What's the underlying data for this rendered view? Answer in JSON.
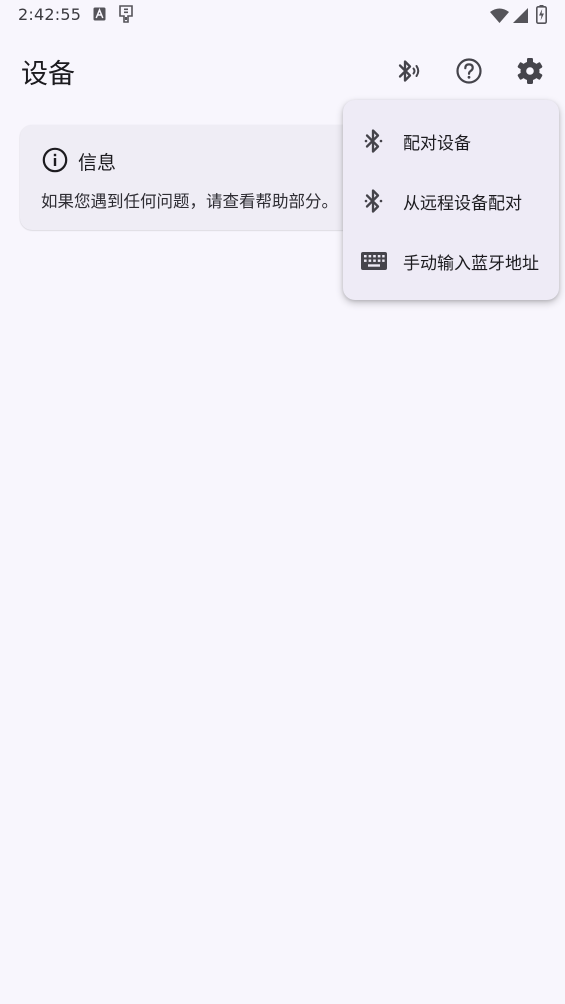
{
  "status_bar": {
    "time": "2:42:55",
    "icons": [
      "a-badge-icon",
      "sim-toolkit-icon",
      "wifi-icon",
      "signal-icon",
      "battery-charging-icon"
    ]
  },
  "app_bar": {
    "title": "设备",
    "actions": [
      "bluetooth-scan-icon",
      "help-icon",
      "settings-icon"
    ]
  },
  "info_card": {
    "icon": "info-icon",
    "title": "信息",
    "text": "如果您遇到任何问题，请查看帮助部分。"
  },
  "overflow_menu": {
    "items": [
      {
        "label": "配对设备",
        "icon": "bluetooth-icon"
      },
      {
        "label": "从远程设备配对",
        "icon": "bluetooth-icon"
      },
      {
        "label": "手动输入蓝牙地址",
        "icon": "keyboard-icon"
      }
    ]
  },
  "colors": {
    "background": "#F8F6FD",
    "card": "#EFEDF5",
    "menu": "#EEEBF6",
    "icon": "#45444B",
    "text": "#1C1B1F"
  }
}
